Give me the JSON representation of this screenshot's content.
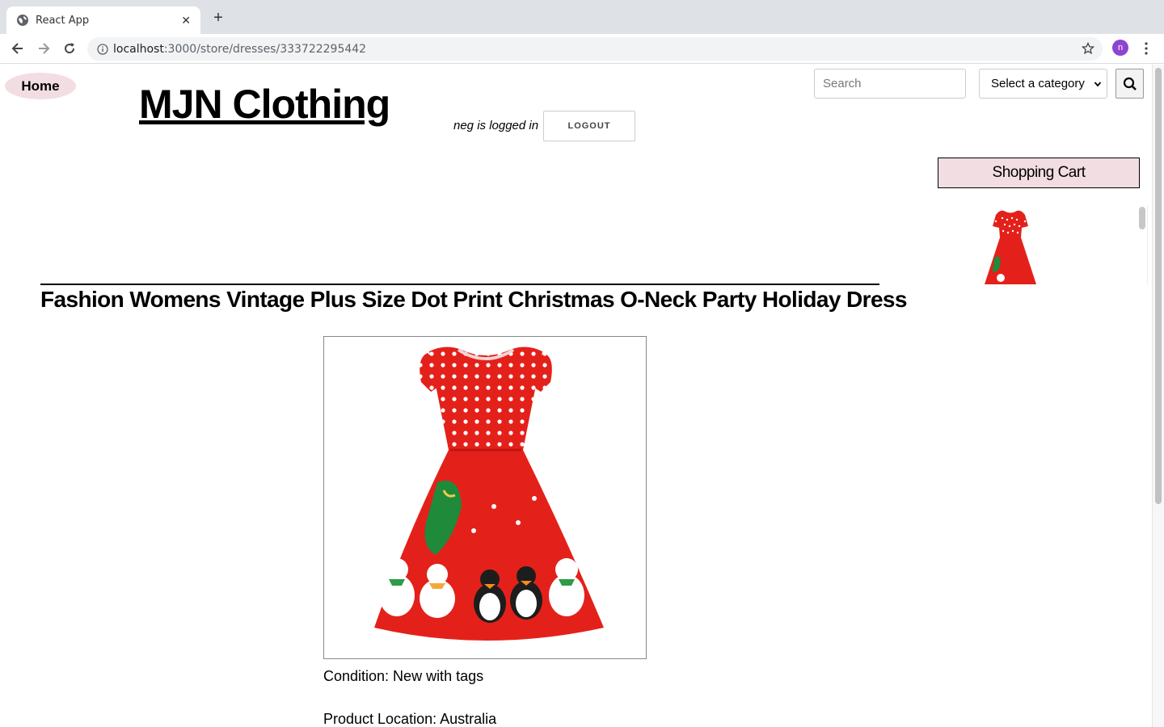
{
  "browser": {
    "tab_title": "React App",
    "url_host": "localhost",
    "url_path": ":3000/store/dresses/333722295442",
    "profile_initial": "n"
  },
  "header": {
    "home_label": "Home",
    "site_title": "MJN Clothing",
    "logged_in_text": "neg is logged in",
    "logout_label": "LOGOUT",
    "search_placeholder": "Search",
    "category_selected": "Select a category"
  },
  "cart": {
    "title": "Shopping Cart",
    "items": [
      {
        "image": "red-polka-dot-christmas-dress"
      }
    ]
  },
  "product": {
    "title": "Fashion Womens Vintage Plus Size Dot Print Christmas O-Neck Party Holiday Dress",
    "image": "red-polka-dot-christmas-dress",
    "condition": "Condition: New with tags",
    "location": "Product Location: Australia"
  },
  "colors": {
    "accent_pink": "#f2dde2",
    "dress_red": "#e3211a",
    "avatar_purple": "#8e44d0"
  },
  "icons": [
    "globe-icon",
    "close-icon",
    "plus-icon",
    "back-icon",
    "forward-icon",
    "reload-icon",
    "info-icon",
    "star-icon",
    "menu-dots-icon",
    "search-icon",
    "chevron-down-icon"
  ]
}
